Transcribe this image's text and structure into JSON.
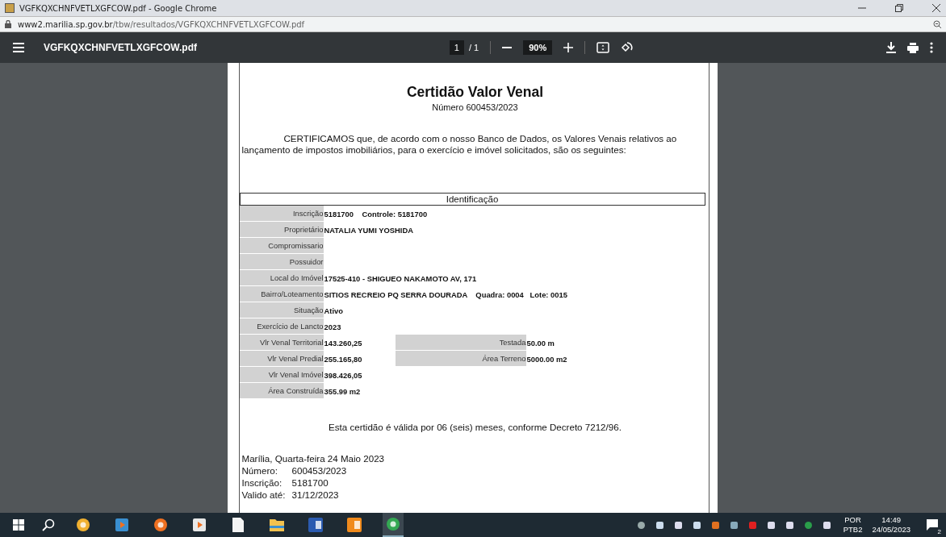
{
  "window": {
    "title": "VGFKQXCHNFVETLXGFCOW.pdf - Google Chrome"
  },
  "address_bar": {
    "url_host": "www2.marilia.sp.gov.br",
    "url_path": "/tbw/resultados/VGFKQXCHNFVETLXGFCOW.pdf"
  },
  "pdf_toolbar": {
    "file_name": "VGFKQXCHNFVETLXGFCOW.pdf",
    "page": "1",
    "page_total": "/ 1",
    "zoom": "90%"
  },
  "document": {
    "title": "Certidão Valor Venal",
    "number_line": "Número 600453/2023",
    "intro": "CERTIFICAMOS que, de acordo com o nosso Banco de Dados, os Valores Venais relativos ao lançamento de impostos imobiliários, para o exercício e imóvel solicitados, são os seguintes:",
    "section_heading": "Identificação",
    "rows": [
      {
        "label": "Inscrição",
        "value": "5181700    Controle: 5181700"
      },
      {
        "label": "Proprietário",
        "value": "NATALIA YUMI YOSHIDA"
      },
      {
        "label": "Compromissario"
      },
      {
        "label": "Possuidor"
      },
      {
        "label": "Local do Imóvel",
        "value": "17525-410 - SHIGUEO NAKAMOTO AV, 171"
      },
      {
        "label": "Bairro/Loteamento",
        "value": "SITIOS RECREIO PQ SERRA DOURADA    Quadra: 0004   Lote: 0015"
      },
      {
        "label": "Situação",
        "value": "Ativo"
      },
      {
        "label": "Exercício de Lancto",
        "value": "2023"
      },
      {
        "label": "Vlr Venal Territorial",
        "value": "143.260,25",
        "side_label": "Testada",
        "side_value": "50.00 m"
      },
      {
        "label": "Vlr Venal Predial",
        "value": "255.165,80",
        "side_label": "Área Terreno",
        "side_value": "5000.00 m2"
      },
      {
        "label": "Vlr Venal Imóvel",
        "value": "398.426,05"
      },
      {
        "label": "Área Construída",
        "value": "355.99 m2"
      }
    ],
    "validity": "Esta certidão é válida por 06 (seis) meses, conforme Decreto 7212/96.",
    "place_date": "Marília, Quarta-feira 24 Maio 2023",
    "footer": [
      {
        "label": "Número:",
        "value": "600453/2023"
      },
      {
        "label": "Inscrição:",
        "value": "5181700"
      },
      {
        "label": "Valido até:",
        "value": "31/12/2023"
      }
    ]
  },
  "taskbar": {
    "apps": [
      {
        "kind": "browser-ring",
        "active": false
      },
      {
        "kind": "player",
        "active": false
      },
      {
        "kind": "firefox",
        "active": false
      },
      {
        "kind": "store",
        "active": false
      },
      {
        "kind": "file",
        "active": false
      },
      {
        "kind": "folder",
        "active": false
      },
      {
        "kind": "word",
        "active": false
      },
      {
        "kind": "outlook",
        "active": false
      },
      {
        "kind": "chrome",
        "active": true
      }
    ],
    "tray": [
      {
        "kind": "s"
      },
      {
        "kind": "usb"
      },
      {
        "kind": "battery"
      },
      {
        "kind": "camera"
      },
      {
        "kind": "flame"
      },
      {
        "kind": "screens"
      },
      {
        "kind": "record"
      },
      {
        "kind": "speaker"
      },
      {
        "kind": "plane"
      },
      {
        "kind": "shield"
      },
      {
        "kind": "pen"
      }
    ],
    "language": "POR",
    "layout": "PTB2",
    "time": "14:49",
    "date": "24/05/2023",
    "notifications": "2"
  }
}
